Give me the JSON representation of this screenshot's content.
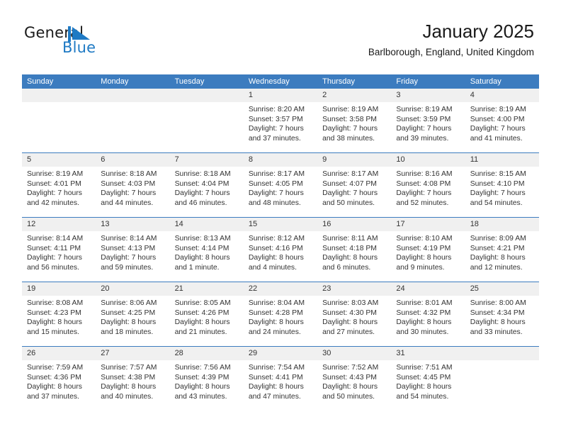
{
  "brand": {
    "name_part1": "General",
    "name_part2": "Blue",
    "flag_icon": "blue-triangle-flag-icon",
    "colors": {
      "brand_blue": "#1f7ac4",
      "header_blue": "#3c7cbf",
      "date_band_grey": "#f0f0f0"
    }
  },
  "header": {
    "title": "January 2025",
    "subtitle": "Barlborough, England, United Kingdom"
  },
  "calendar": {
    "weekday_headers": [
      "Sunday",
      "Monday",
      "Tuesday",
      "Wednesday",
      "Thursday",
      "Friday",
      "Saturday"
    ],
    "weeks": [
      {
        "days": [
          {
            "num": "",
            "empty": true,
            "lines": []
          },
          {
            "num": "",
            "empty": true,
            "lines": []
          },
          {
            "num": "",
            "empty": true,
            "lines": []
          },
          {
            "num": "1",
            "empty": false,
            "lines": [
              "Sunrise: 8:20 AM",
              "Sunset: 3:57 PM",
              "Daylight: 7 hours",
              "and 37 minutes."
            ]
          },
          {
            "num": "2",
            "empty": false,
            "lines": [
              "Sunrise: 8:19 AM",
              "Sunset: 3:58 PM",
              "Daylight: 7 hours",
              "and 38 minutes."
            ]
          },
          {
            "num": "3",
            "empty": false,
            "lines": [
              "Sunrise: 8:19 AM",
              "Sunset: 3:59 PM",
              "Daylight: 7 hours",
              "and 39 minutes."
            ]
          },
          {
            "num": "4",
            "empty": false,
            "lines": [
              "Sunrise: 8:19 AM",
              "Sunset: 4:00 PM",
              "Daylight: 7 hours",
              "and 41 minutes."
            ]
          }
        ]
      },
      {
        "days": [
          {
            "num": "5",
            "empty": false,
            "lines": [
              "Sunrise: 8:19 AM",
              "Sunset: 4:01 PM",
              "Daylight: 7 hours",
              "and 42 minutes."
            ]
          },
          {
            "num": "6",
            "empty": false,
            "lines": [
              "Sunrise: 8:18 AM",
              "Sunset: 4:03 PM",
              "Daylight: 7 hours",
              "and 44 minutes."
            ]
          },
          {
            "num": "7",
            "empty": false,
            "lines": [
              "Sunrise: 8:18 AM",
              "Sunset: 4:04 PM",
              "Daylight: 7 hours",
              "and 46 minutes."
            ]
          },
          {
            "num": "8",
            "empty": false,
            "lines": [
              "Sunrise: 8:17 AM",
              "Sunset: 4:05 PM",
              "Daylight: 7 hours",
              "and 48 minutes."
            ]
          },
          {
            "num": "9",
            "empty": false,
            "lines": [
              "Sunrise: 8:17 AM",
              "Sunset: 4:07 PM",
              "Daylight: 7 hours",
              "and 50 minutes."
            ]
          },
          {
            "num": "10",
            "empty": false,
            "lines": [
              "Sunrise: 8:16 AM",
              "Sunset: 4:08 PM",
              "Daylight: 7 hours",
              "and 52 minutes."
            ]
          },
          {
            "num": "11",
            "empty": false,
            "lines": [
              "Sunrise: 8:15 AM",
              "Sunset: 4:10 PM",
              "Daylight: 7 hours",
              "and 54 minutes."
            ]
          }
        ]
      },
      {
        "days": [
          {
            "num": "12",
            "empty": false,
            "lines": [
              "Sunrise: 8:14 AM",
              "Sunset: 4:11 PM",
              "Daylight: 7 hours",
              "and 56 minutes."
            ]
          },
          {
            "num": "13",
            "empty": false,
            "lines": [
              "Sunrise: 8:14 AM",
              "Sunset: 4:13 PM",
              "Daylight: 7 hours",
              "and 59 minutes."
            ]
          },
          {
            "num": "14",
            "empty": false,
            "lines": [
              "Sunrise: 8:13 AM",
              "Sunset: 4:14 PM",
              "Daylight: 8 hours",
              "and 1 minute."
            ]
          },
          {
            "num": "15",
            "empty": false,
            "lines": [
              "Sunrise: 8:12 AM",
              "Sunset: 4:16 PM",
              "Daylight: 8 hours",
              "and 4 minutes."
            ]
          },
          {
            "num": "16",
            "empty": false,
            "lines": [
              "Sunrise: 8:11 AM",
              "Sunset: 4:18 PM",
              "Daylight: 8 hours",
              "and 6 minutes."
            ]
          },
          {
            "num": "17",
            "empty": false,
            "lines": [
              "Sunrise: 8:10 AM",
              "Sunset: 4:19 PM",
              "Daylight: 8 hours",
              "and 9 minutes."
            ]
          },
          {
            "num": "18",
            "empty": false,
            "lines": [
              "Sunrise: 8:09 AM",
              "Sunset: 4:21 PM",
              "Daylight: 8 hours",
              "and 12 minutes."
            ]
          }
        ]
      },
      {
        "days": [
          {
            "num": "19",
            "empty": false,
            "lines": [
              "Sunrise: 8:08 AM",
              "Sunset: 4:23 PM",
              "Daylight: 8 hours",
              "and 15 minutes."
            ]
          },
          {
            "num": "20",
            "empty": false,
            "lines": [
              "Sunrise: 8:06 AM",
              "Sunset: 4:25 PM",
              "Daylight: 8 hours",
              "and 18 minutes."
            ]
          },
          {
            "num": "21",
            "empty": false,
            "lines": [
              "Sunrise: 8:05 AM",
              "Sunset: 4:26 PM",
              "Daylight: 8 hours",
              "and 21 minutes."
            ]
          },
          {
            "num": "22",
            "empty": false,
            "lines": [
              "Sunrise: 8:04 AM",
              "Sunset: 4:28 PM",
              "Daylight: 8 hours",
              "and 24 minutes."
            ]
          },
          {
            "num": "23",
            "empty": false,
            "lines": [
              "Sunrise: 8:03 AM",
              "Sunset: 4:30 PM",
              "Daylight: 8 hours",
              "and 27 minutes."
            ]
          },
          {
            "num": "24",
            "empty": false,
            "lines": [
              "Sunrise: 8:01 AM",
              "Sunset: 4:32 PM",
              "Daylight: 8 hours",
              "and 30 minutes."
            ]
          },
          {
            "num": "25",
            "empty": false,
            "lines": [
              "Sunrise: 8:00 AM",
              "Sunset: 4:34 PM",
              "Daylight: 8 hours",
              "and 33 minutes."
            ]
          }
        ]
      },
      {
        "days": [
          {
            "num": "26",
            "empty": false,
            "lines": [
              "Sunrise: 7:59 AM",
              "Sunset: 4:36 PM",
              "Daylight: 8 hours",
              "and 37 minutes."
            ]
          },
          {
            "num": "27",
            "empty": false,
            "lines": [
              "Sunrise: 7:57 AM",
              "Sunset: 4:38 PM",
              "Daylight: 8 hours",
              "and 40 minutes."
            ]
          },
          {
            "num": "28",
            "empty": false,
            "lines": [
              "Sunrise: 7:56 AM",
              "Sunset: 4:39 PM",
              "Daylight: 8 hours",
              "and 43 minutes."
            ]
          },
          {
            "num": "29",
            "empty": false,
            "lines": [
              "Sunrise: 7:54 AM",
              "Sunset: 4:41 PM",
              "Daylight: 8 hours",
              "and 47 minutes."
            ]
          },
          {
            "num": "30",
            "empty": false,
            "lines": [
              "Sunrise: 7:52 AM",
              "Sunset: 4:43 PM",
              "Daylight: 8 hours",
              "and 50 minutes."
            ]
          },
          {
            "num": "31",
            "empty": false,
            "lines": [
              "Sunrise: 7:51 AM",
              "Sunset: 4:45 PM",
              "Daylight: 8 hours",
              "and 54 minutes."
            ]
          },
          {
            "num": "",
            "empty": true,
            "lines": []
          }
        ]
      }
    ]
  }
}
